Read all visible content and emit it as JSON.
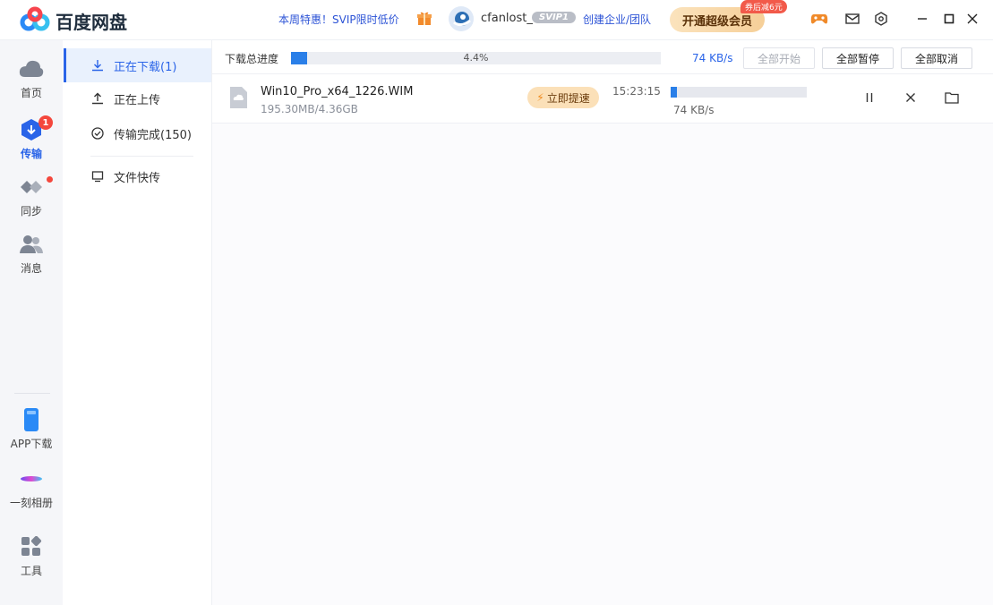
{
  "app": {
    "brand": "百度网盘",
    "promo": "本周特惠！SVIP限时低价",
    "username": "cfanlost_",
    "svip_badge": "SVIP1",
    "enterprise_link": "创建企业/团队",
    "vip_button": "开通超级会员",
    "vip_badge": "券后减6元"
  },
  "leftnav": {
    "items": [
      {
        "label": "首页",
        "icon": "cloud-icon"
      },
      {
        "label": "传输",
        "icon": "transfer-icon",
        "badge": "1"
      },
      {
        "label": "同步",
        "icon": "sync-icon"
      },
      {
        "label": "消息",
        "icon": "contacts-icon"
      }
    ],
    "bottom": [
      {
        "label": "APP下载",
        "icon": "phone-icon"
      },
      {
        "label": "一刻相册",
        "icon": "album-icon"
      },
      {
        "label": "工具",
        "icon": "tools-icon"
      }
    ]
  },
  "subnav": {
    "items": [
      {
        "label": "正在下载(1)",
        "icon": "download-icon"
      },
      {
        "label": "正在上传",
        "icon": "upload-icon"
      },
      {
        "label": "传输完成(150)",
        "icon": "check-circle-icon"
      },
      {
        "label": "文件快传",
        "icon": "monitor-icon"
      }
    ]
  },
  "total": {
    "label": "下载总进度",
    "percent_text": "4.4%",
    "percent": 4.4,
    "speed": "74 KB/s",
    "buttons": {
      "start_all": "全部开始",
      "pause_all": "全部暂停",
      "cancel_all": "全部取消"
    }
  },
  "downloads": [
    {
      "name": "Win10_Pro_x64_1226.WIM",
      "size": "195.30MB/4.36GB",
      "boost": "立即提速",
      "time": "15:23:15",
      "percent": 4.4,
      "speed": "74 KB/s"
    }
  ],
  "colors": {
    "accent": "#2a64e8",
    "progress": "#2a7fe8",
    "badge": "#f4473d"
  }
}
